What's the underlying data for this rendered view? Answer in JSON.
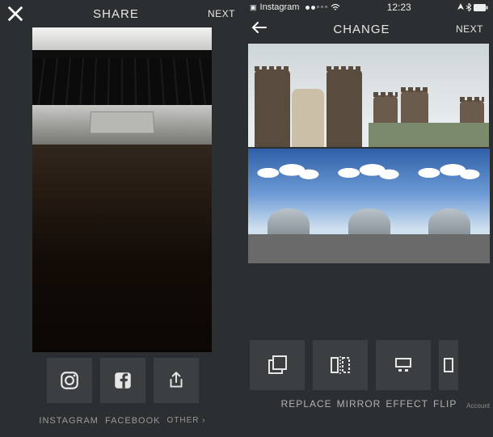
{
  "left": {
    "title": "SHARE",
    "next": "NEXT",
    "share_buttons": {
      "instagram": {
        "label": "INSTAGRAM",
        "icon": "instagram-icon"
      },
      "facebook": {
        "label": "FACEBOOK",
        "icon": "facebook-icon"
      },
      "other": {
        "label": "OTHER ›",
        "icon": "share-icon"
      }
    }
  },
  "right": {
    "statusbar": {
      "carrier": "Instagram",
      "time": "12:23"
    },
    "title": "CHANGE",
    "next": "NEXT",
    "tools": {
      "replace": {
        "label": "REPLACE",
        "icon": "replace-icon"
      },
      "mirror": {
        "label": "MIRROR",
        "icon": "mirror-icon"
      },
      "effect": {
        "label": "EFFECT",
        "icon": "effect-icon"
      },
      "flip": {
        "label": "FLIP",
        "icon": "flip-icon"
      }
    },
    "account_label": "Account"
  }
}
